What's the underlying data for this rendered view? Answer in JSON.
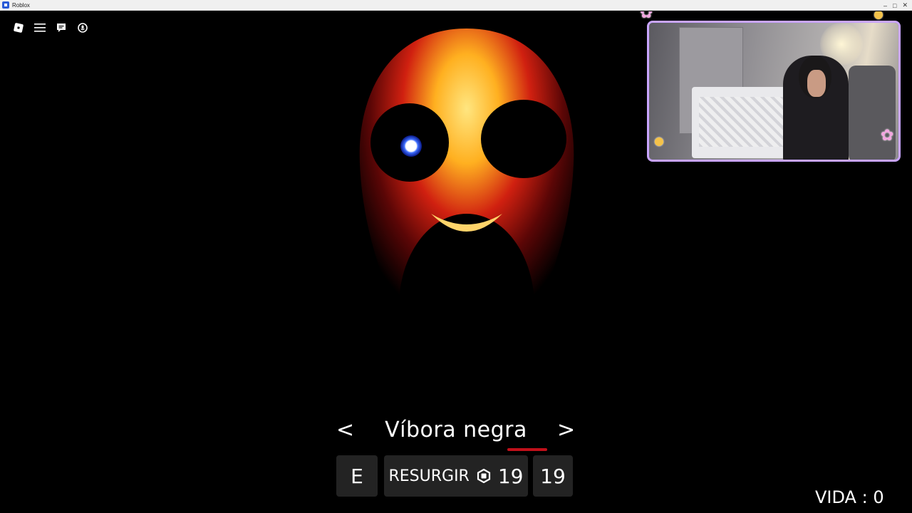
{
  "window": {
    "title": "Roblox",
    "controls": [
      "minimize",
      "maximize",
      "close"
    ]
  },
  "topmenu": {
    "items": [
      {
        "name": "roblox-logo-icon"
      },
      {
        "name": "menu-icon"
      },
      {
        "name": "chat-icon"
      },
      {
        "name": "voice-icon"
      }
    ]
  },
  "game": {
    "character_selector": {
      "name": "Víbora negra",
      "prev_arrow": "<",
      "next_arrow": ">"
    },
    "buttons": {
      "key_label": "E",
      "resurgir_label": "RESURGIR",
      "resurgir_price": "19",
      "count_label": "19"
    },
    "vida_text": "VIDA : 0"
  },
  "webcam": {
    "frame_color": "#c9a5ff"
  },
  "colors": {
    "accent_red": "#c1101a",
    "button_bg": "#232323"
  }
}
